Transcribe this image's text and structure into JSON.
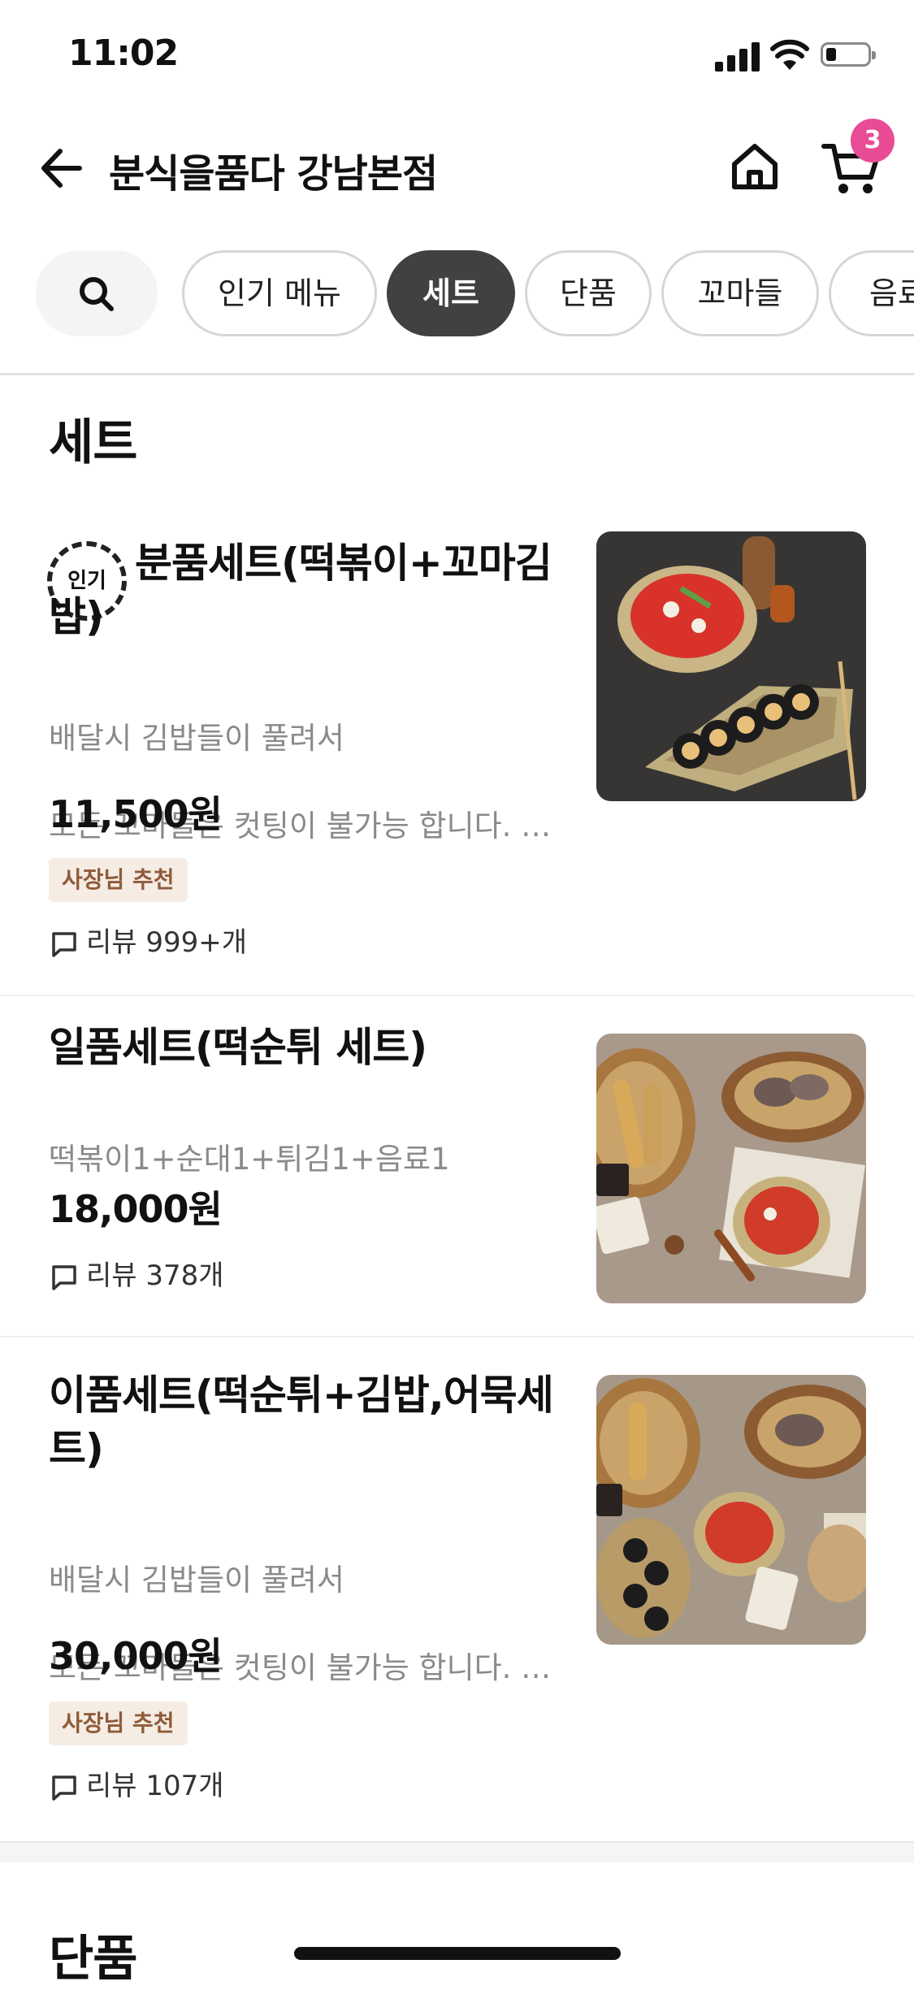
{
  "status_bar": {
    "time": "11:02"
  },
  "header": {
    "title": "분식을품다 강남본점",
    "cart_count": "3"
  },
  "tabs": [
    {
      "label": "인기 메뉴"
    },
    {
      "label": "세트",
      "active": true
    },
    {
      "label": "단품"
    },
    {
      "label": "꼬마들"
    },
    {
      "label": "음료"
    }
  ],
  "sections": [
    {
      "title": "세트",
      "items": [
        {
          "popular_label": "인기",
          "name": "분품세트(떡볶이+꼬마김밥)",
          "desc_line1": "배달시 김밥들이 풀려서",
          "desc_line2": "모든 꼬마들은 컷팅이 불가능 합니다. 양해 부탁드립니다.",
          "price": "11,500원",
          "recommend": "사장님 추천",
          "review": "리뷰 999+개"
        },
        {
          "name": "일품세트(떡순튀 세트)",
          "desc_line1": "떡볶이1+순대1+튀김1+음료1",
          "price": "18,000원",
          "review": "리뷰 378개"
        },
        {
          "name": "이품세트(떡순튀+김밥,어묵세트)",
          "desc_line1": "배달시 김밥들이 풀려서",
          "desc_line2": "모든 꼬마들은 컷팅이 불가능 합니다. 양해 부탁드립니다.",
          "price": "30,000원",
          "recommend": "사장님 추천",
          "review": "리뷰 107개"
        }
      ]
    },
    {
      "title": "단품"
    }
  ],
  "colors": {
    "accent_badge": "#e84c95",
    "active_tab": "#3f4142",
    "recommend_bg": "#f5ece4",
    "recommend_text": "#8f5b3a"
  }
}
